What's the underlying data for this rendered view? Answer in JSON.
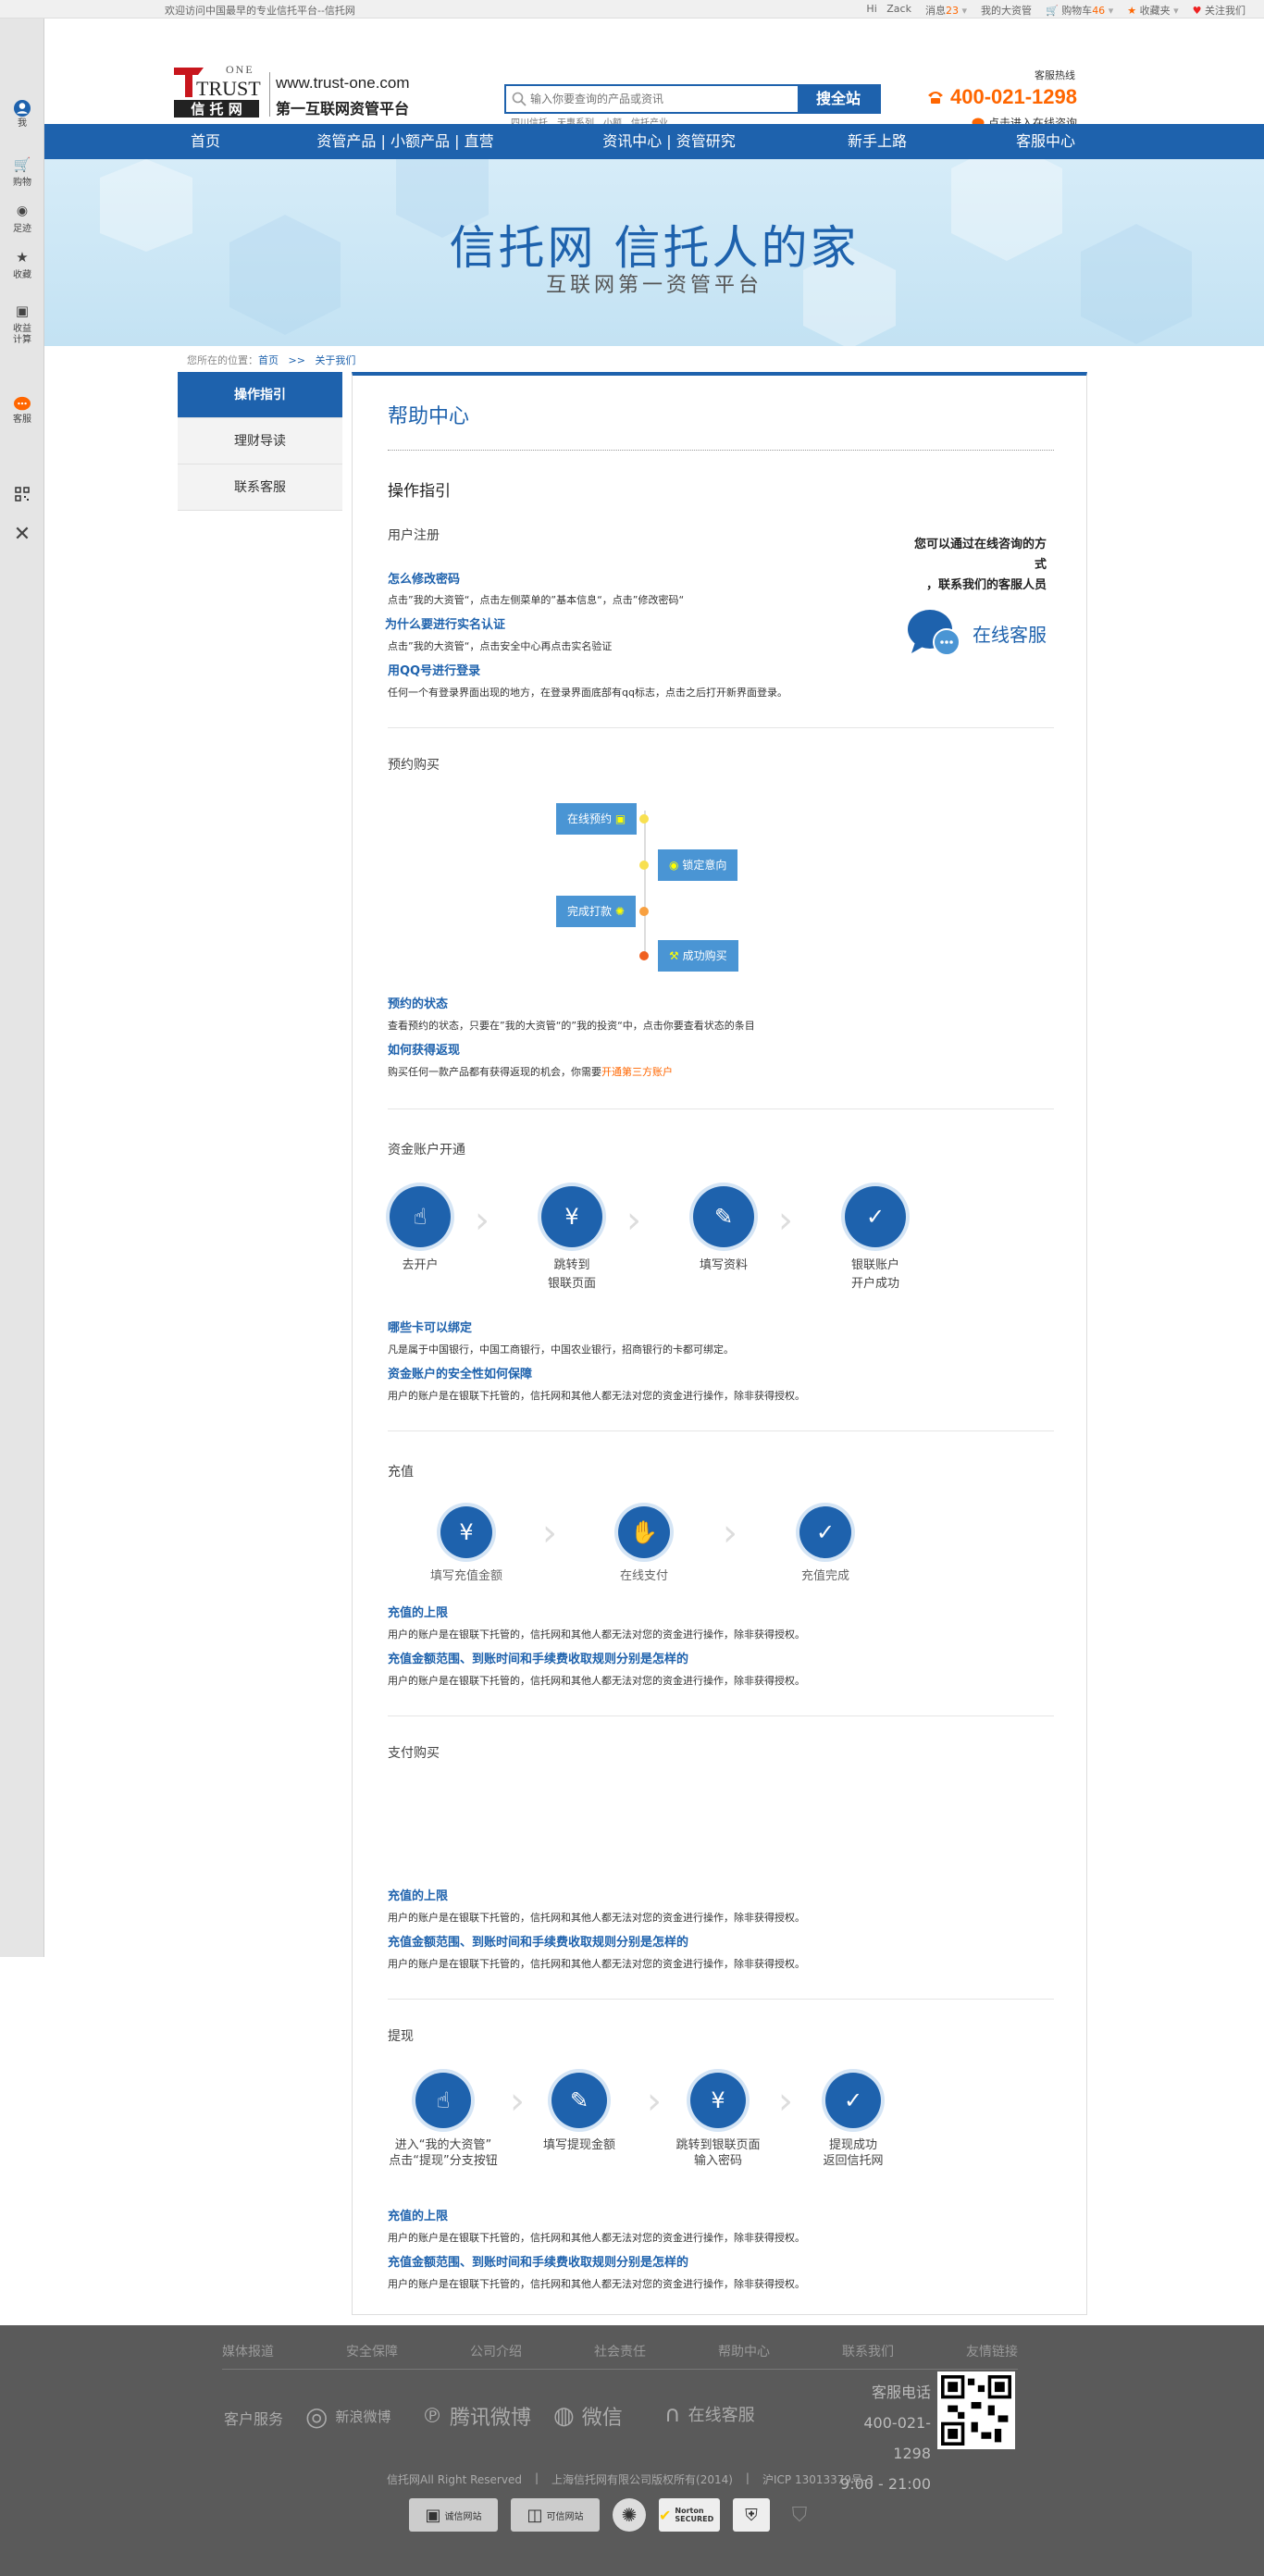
{
  "topbar": {
    "welcome": "欢迎访问中国最早的专业信托平台--信托网",
    "hi": "Hi",
    "user": "Zack",
    "msg_label": "消息",
    "msg_count": "23",
    "my_assets": "我的大资管",
    "cart_label": "购物车",
    "cart_count": "46",
    "favorites": "收藏夹",
    "follow": "关注我们"
  },
  "sidebar": {
    "me": "我",
    "cart": "购物",
    "footprint": "足迹",
    "collect": "收藏",
    "calc": "收益计算",
    "service": "客服"
  },
  "header": {
    "logo_one": "ONE",
    "logo_trust": "TRUST",
    "logo_cn": "信 托 网",
    "site": "www.trust-one.com",
    "slogan": "第一互联网资管平台",
    "search_placeholder": "输入你要查询的产品或资讯",
    "search_btn": "搜全站",
    "hot": [
      "四川信托",
      "天惠系列",
      "小额",
      "信托产业"
    ],
    "hotline_label": "客服热线",
    "phone": "400-021-1298",
    "consult": "点击进入在线咨询"
  },
  "nav": {
    "home": "首页",
    "products": "资管产品",
    "small": "小额产品",
    "direct": "直营店",
    "news": "资讯中心",
    "research": "资管研究",
    "newbie": "新手上路",
    "service": "客服中心"
  },
  "banner": {
    "title": "信托网 信托人的家",
    "subtitle": "互联网第一资管平台"
  },
  "breadcrumb": {
    "label": "您所在的位置：",
    "home": "首页",
    "sep": ">>",
    "current": "关于我们"
  },
  "leftnav": {
    "guide": "操作指引",
    "finance": "理财导读",
    "contact": "联系客服"
  },
  "main": {
    "title": "帮助中心",
    "guide_title": "操作指引",
    "register": {
      "title": "用户注册",
      "q1": "怎么修改密码",
      "a1": "点击”我的大资管“，点击左侧菜单的”基本信息“，点击”修改密码“",
      "q2": "为什么要进行实名认证",
      "a2": "点击”我的大资管“，点击安全中心再点击实名验证",
      "q3": "用QQ号进行登录",
      "a3": "任何一个有登录界面出现的地方，在登录界面底部有qq标志，点击之后打开新界面登录。"
    },
    "cs": {
      "text1": "您可以通过在线咨询的方式",
      "text2": "，联系我们的客服人员",
      "btn": "在线客服"
    },
    "reserve": {
      "title": "预约购买",
      "f1": "在线预约",
      "f2": "锁定意向",
      "f3": "完成打款",
      "f4": "成功购买",
      "q1": "预约的状态",
      "a1": "查看预约的状态，只要在”我的大资管“的”我的投资“中，点击你要查看状态的条目",
      "q2": "如何获得返现",
      "a2": "购买任何一款产品都有获得返现的机会，你需要",
      "a2_link": "开通第三方账户"
    },
    "account": {
      "title": "资金账户开通",
      "s1": "去开户",
      "s2a": "跳转到",
      "s2b": "银联页面",
      "s3": "填写资料",
      "s4a": "银联账户",
      "s4b": "开户成功",
      "q1": "哪些卡可以绑定",
      "a1": "凡是属于中国银行，中国工商银行，中国农业银行，招商银行的卡都可绑定。",
      "q2": "资金账户的安全性如何保障",
      "a2": "用户的账户是在银联下托管的，信托网和其他人都无法对您的资金进行操作，除非获得授权。"
    },
    "recharge": {
      "title": "充值",
      "s1": "填写充值金额",
      "s2": "在线支付",
      "s3": "充值完成",
      "q1": "充值的上限",
      "a1": "用户的账户是在银联下托管的，信托网和其他人都无法对您的资金进行操作，除非获得授权。",
      "q2": "充值金额范围、到账时间和手续费收取规则分别是怎样的",
      "a2": "用户的账户是在银联下托管的，信托网和其他人都无法对您的资金进行操作，除非获得授权。"
    },
    "pay": {
      "title": "支付购买",
      "q1": "充值的上限",
      "a1": "用户的账户是在银联下托管的，信托网和其他人都无法对您的资金进行操作，除非获得授权。",
      "q2": "充值金额范围、到账时间和手续费收取规则分别是怎样的",
      "a2": "用户的账户是在银联下托管的，信托网和其他人都无法对您的资金进行操作，除非获得授权。"
    },
    "withdraw": {
      "title": "提现",
      "s1a": "进入“我的大资管”",
      "s1b": "点击“提现”分支按钮",
      "s2": "填写提现金额",
      "s3a": "跳转到银联页面",
      "s3b": "输入密码",
      "s4a": "提现成功",
      "s4b": "返回信托网",
      "q1": "充值的上限",
      "a1": "用户的账户是在银联下托管的，信托网和其他人都无法对您的资金进行操作，除非获得授权。",
      "q2": "充值金额范围、到账时间和手续费收取规则分别是怎样的",
      "a2": "用户的账户是在银联下托管的，信托网和其他人都无法对您的资金进行操作，除非获得授权。"
    }
  },
  "footer": {
    "links": [
      "媒体报道",
      "安全保障",
      "公司介绍",
      "社会责任",
      "帮助中心",
      "联系我们",
      "友情链接"
    ],
    "svc": "客户服务",
    "weibo": "新浪微博",
    "tencent": "腾讯微博",
    "wechat": "微信",
    "online": "在线客服",
    "contact_label": "客服电话",
    "phone": "400-021-1298",
    "hours": "9:00 - 21:00",
    "copy1": "信托网All Right Reserved",
    "copy2": "上海信托网有限公司版权所有(2014)",
    "copy3": "沪ICP 13013379号-3",
    "b1": "诚信网站",
    "b2": "可信网站",
    "b4": "Norton SECURED"
  },
  "colors": {
    "brand": "#1e62ad",
    "accent": "#ff6600",
    "footer": "#5a5a5a"
  }
}
